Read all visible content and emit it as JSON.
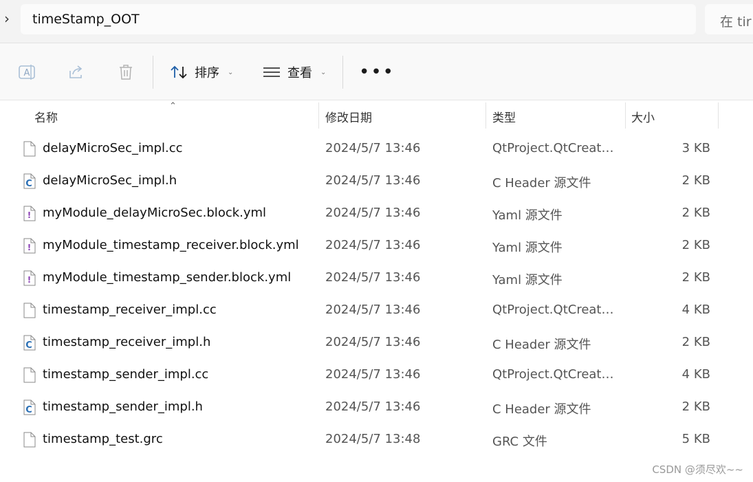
{
  "address": {
    "folder": "timeStamp_OOT",
    "search_placeholder": "在 tir"
  },
  "toolbar": {
    "sort_label": "排序",
    "view_label": "查看"
  },
  "columns": {
    "name": "名称",
    "modified": "修改日期",
    "type": "类型",
    "size": "大小"
  },
  "files": [
    {
      "name": "delayMicroSec_impl.cc",
      "date": "2024/5/7 13:46",
      "type": "QtProject.QtCreato...",
      "size": "3 KB",
      "icon": "blank"
    },
    {
      "name": "delayMicroSec_impl.h",
      "date": "2024/5/7 13:46",
      "type": "C Header 源文件",
      "size": "2 KB",
      "icon": "c"
    },
    {
      "name": "myModule_delayMicroSec.block.yml",
      "date": "2024/5/7 13:46",
      "type": "Yaml 源文件",
      "size": "2 KB",
      "icon": "yaml"
    },
    {
      "name": "myModule_timestamp_receiver.block.yml",
      "date": "2024/5/7 13:46",
      "type": "Yaml 源文件",
      "size": "2 KB",
      "icon": "yaml"
    },
    {
      "name": "myModule_timestamp_sender.block.yml",
      "date": "2024/5/7 13:46",
      "type": "Yaml 源文件",
      "size": "2 KB",
      "icon": "yaml"
    },
    {
      "name": "timestamp_receiver_impl.cc",
      "date": "2024/5/7 13:46",
      "type": "QtProject.QtCreato...",
      "size": "4 KB",
      "icon": "blank"
    },
    {
      "name": "timestamp_receiver_impl.h",
      "date": "2024/5/7 13:46",
      "type": "C Header 源文件",
      "size": "2 KB",
      "icon": "c"
    },
    {
      "name": "timestamp_sender_impl.cc",
      "date": "2024/5/7 13:46",
      "type": "QtProject.QtCreato...",
      "size": "4 KB",
      "icon": "blank"
    },
    {
      "name": "timestamp_sender_impl.h",
      "date": "2024/5/7 13:46",
      "type": "C Header 源文件",
      "size": "2 KB",
      "icon": "c"
    },
    {
      "name": "timestamp_test.grc",
      "date": "2024/5/7 13:48",
      "type": "GRC 文件",
      "size": "5 KB",
      "icon": "blank"
    }
  ],
  "watermark": "CSDN @须尽欢~~"
}
